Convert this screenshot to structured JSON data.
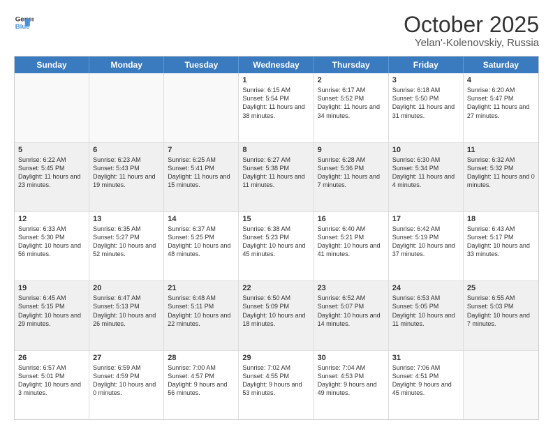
{
  "logo": {
    "line1": "General",
    "line2": "Blue"
  },
  "title": "October 2025",
  "location": "Yelan'-Kolenovskiy, Russia",
  "weekdays": [
    "Sunday",
    "Monday",
    "Tuesday",
    "Wednesday",
    "Thursday",
    "Friday",
    "Saturday"
  ],
  "rows": [
    [
      {
        "day": "",
        "text": "",
        "empty": true
      },
      {
        "day": "",
        "text": "",
        "empty": true
      },
      {
        "day": "",
        "text": "",
        "empty": true
      },
      {
        "day": "1",
        "text": "Sunrise: 6:15 AM\nSunset: 5:54 PM\nDaylight: 11 hours and 38 minutes."
      },
      {
        "day": "2",
        "text": "Sunrise: 6:17 AM\nSunset: 5:52 PM\nDaylight: 11 hours and 34 minutes."
      },
      {
        "day": "3",
        "text": "Sunrise: 6:18 AM\nSunset: 5:50 PM\nDaylight: 11 hours and 31 minutes."
      },
      {
        "day": "4",
        "text": "Sunrise: 6:20 AM\nSunset: 5:47 PM\nDaylight: 11 hours and 27 minutes."
      }
    ],
    [
      {
        "day": "5",
        "text": "Sunrise: 6:22 AM\nSunset: 5:45 PM\nDaylight: 11 hours and 23 minutes."
      },
      {
        "day": "6",
        "text": "Sunrise: 6:23 AM\nSunset: 5:43 PM\nDaylight: 11 hours and 19 minutes."
      },
      {
        "day": "7",
        "text": "Sunrise: 6:25 AM\nSunset: 5:41 PM\nDaylight: 11 hours and 15 minutes."
      },
      {
        "day": "8",
        "text": "Sunrise: 6:27 AM\nSunset: 5:38 PM\nDaylight: 11 hours and 11 minutes."
      },
      {
        "day": "9",
        "text": "Sunrise: 6:28 AM\nSunset: 5:36 PM\nDaylight: 11 hours and 7 minutes."
      },
      {
        "day": "10",
        "text": "Sunrise: 6:30 AM\nSunset: 5:34 PM\nDaylight: 11 hours and 4 minutes."
      },
      {
        "day": "11",
        "text": "Sunrise: 6:32 AM\nSunset: 5:32 PM\nDaylight: 11 hours and 0 minutes."
      }
    ],
    [
      {
        "day": "12",
        "text": "Sunrise: 6:33 AM\nSunset: 5:30 PM\nDaylight: 10 hours and 56 minutes."
      },
      {
        "day": "13",
        "text": "Sunrise: 6:35 AM\nSunset: 5:27 PM\nDaylight: 10 hours and 52 minutes."
      },
      {
        "day": "14",
        "text": "Sunrise: 6:37 AM\nSunset: 5:25 PM\nDaylight: 10 hours and 48 minutes."
      },
      {
        "day": "15",
        "text": "Sunrise: 6:38 AM\nSunset: 5:23 PM\nDaylight: 10 hours and 45 minutes."
      },
      {
        "day": "16",
        "text": "Sunrise: 6:40 AM\nSunset: 5:21 PM\nDaylight: 10 hours and 41 minutes."
      },
      {
        "day": "17",
        "text": "Sunrise: 6:42 AM\nSunset: 5:19 PM\nDaylight: 10 hours and 37 minutes."
      },
      {
        "day": "18",
        "text": "Sunrise: 6:43 AM\nSunset: 5:17 PM\nDaylight: 10 hours and 33 minutes."
      }
    ],
    [
      {
        "day": "19",
        "text": "Sunrise: 6:45 AM\nSunset: 5:15 PM\nDaylight: 10 hours and 29 minutes."
      },
      {
        "day": "20",
        "text": "Sunrise: 6:47 AM\nSunset: 5:13 PM\nDaylight: 10 hours and 26 minutes."
      },
      {
        "day": "21",
        "text": "Sunrise: 6:48 AM\nSunset: 5:11 PM\nDaylight: 10 hours and 22 minutes."
      },
      {
        "day": "22",
        "text": "Sunrise: 6:50 AM\nSunset: 5:09 PM\nDaylight: 10 hours and 18 minutes."
      },
      {
        "day": "23",
        "text": "Sunrise: 6:52 AM\nSunset: 5:07 PM\nDaylight: 10 hours and 14 minutes."
      },
      {
        "day": "24",
        "text": "Sunrise: 6:53 AM\nSunset: 5:05 PM\nDaylight: 10 hours and 11 minutes."
      },
      {
        "day": "25",
        "text": "Sunrise: 6:55 AM\nSunset: 5:03 PM\nDaylight: 10 hours and 7 minutes."
      }
    ],
    [
      {
        "day": "26",
        "text": "Sunrise: 6:57 AM\nSunset: 5:01 PM\nDaylight: 10 hours and 3 minutes."
      },
      {
        "day": "27",
        "text": "Sunrise: 6:59 AM\nSunset: 4:59 PM\nDaylight: 10 hours and 0 minutes."
      },
      {
        "day": "28",
        "text": "Sunrise: 7:00 AM\nSunset: 4:57 PM\nDaylight: 9 hours and 56 minutes."
      },
      {
        "day": "29",
        "text": "Sunrise: 7:02 AM\nSunset: 4:55 PM\nDaylight: 9 hours and 53 minutes."
      },
      {
        "day": "30",
        "text": "Sunrise: 7:04 AM\nSunset: 4:53 PM\nDaylight: 9 hours and 49 minutes."
      },
      {
        "day": "31",
        "text": "Sunrise: 7:06 AM\nSunset: 4:51 PM\nDaylight: 9 hours and 45 minutes."
      },
      {
        "day": "",
        "text": "",
        "empty": true
      }
    ]
  ]
}
